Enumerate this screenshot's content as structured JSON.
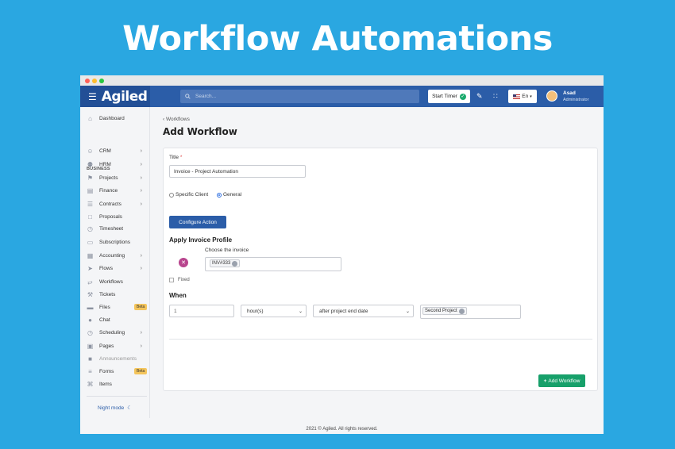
{
  "hero": {
    "title": "Workflow Automations"
  },
  "topbar": {
    "brand": "Agiled",
    "search_placeholder": "Search...",
    "start_timer": "Start Timer",
    "language": "En",
    "user_name": "Asad",
    "user_role": "Administrator"
  },
  "sidebar": {
    "dashboard": "Dashboard",
    "section_business": "BUSINESS",
    "items": [
      {
        "label": "CRM",
        "icon": "person-icon",
        "chevron": true
      },
      {
        "label": "HRM",
        "icon": "people-icon",
        "chevron": true
      },
      {
        "label": "Projects",
        "icon": "projects-icon",
        "chevron": true
      },
      {
        "label": "Finance",
        "icon": "finance-icon",
        "chevron": true
      },
      {
        "label": "Contracts",
        "icon": "contracts-icon",
        "chevron": true
      },
      {
        "label": "Proposals",
        "icon": "proposals-icon",
        "chevron": false
      },
      {
        "label": "Timesheet",
        "icon": "clock-icon",
        "chevron": false
      },
      {
        "label": "Subscriptions",
        "icon": "subscriptions-icon",
        "chevron": false
      },
      {
        "label": "Accounting",
        "icon": "accounting-icon",
        "chevron": true
      },
      {
        "label": "Flows",
        "icon": "flows-icon",
        "chevron": true
      },
      {
        "label": "Workflows",
        "icon": "workflows-icon",
        "chevron": false
      },
      {
        "label": "Tickets",
        "icon": "wrench-icon",
        "chevron": false
      },
      {
        "label": "Files",
        "icon": "folder-icon",
        "chevron": false,
        "badge": "Beta"
      },
      {
        "label": "Chat",
        "icon": "chat-icon",
        "chevron": false
      },
      {
        "label": "Scheduling",
        "icon": "clock-icon",
        "chevron": true
      },
      {
        "label": "Pages",
        "icon": "pages-icon",
        "chevron": true
      },
      {
        "label": "Announcements",
        "icon": "announcements-icon",
        "chevron": false,
        "disabled": true
      },
      {
        "label": "Forms",
        "icon": "forms-icon",
        "chevron": false,
        "badge": "Beta"
      },
      {
        "label": "Items",
        "icon": "cart-icon",
        "chevron": false
      }
    ],
    "night_mode": "Night mode"
  },
  "main": {
    "breadcrumb": "Workflows",
    "page_title": "Add Workflow",
    "title_label": "Title",
    "title_required": "*",
    "title_value": "Invoice - Project Automation",
    "radio_specific": "Specific Client",
    "radio_general": "General",
    "selected_radio": "General",
    "configure_action": "Configure Action",
    "apply_invoice_profile": "Apply Invoice Profile",
    "choose_invoice_label": "Choose the invoice",
    "invoice_tag": "INV#333",
    "fixed_label": "Fixed",
    "when_heading": "When",
    "when_amount": "1",
    "when_unit": "hour(s)",
    "when_trigger": "after project end date",
    "project_tag": "Second Project",
    "add_workflow": "Add Workflow"
  },
  "footer": {
    "text": "2021 © Agiled. All rights reserved."
  },
  "colors": {
    "background": "#2aa7e1",
    "topbar": "#2b5da8",
    "primary_button": "#2b5da8",
    "success_button": "#17a06a",
    "remove_circle": "#b8458e",
    "beta_badge": "#f4c55c"
  }
}
